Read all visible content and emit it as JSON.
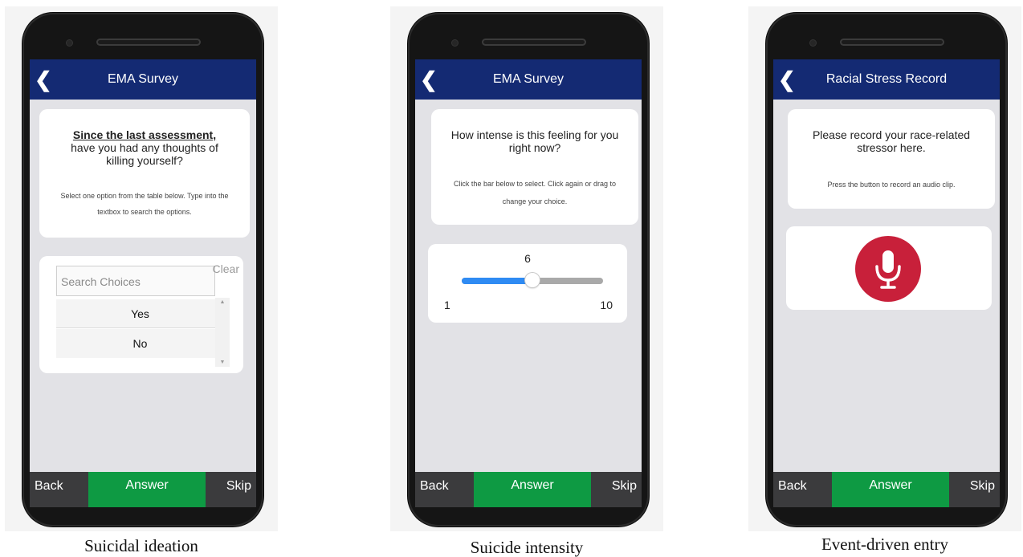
{
  "panels": [
    {
      "header_title": "EMA Survey",
      "question_emphasis": "Since the last assessment,",
      "question_line2": "have you had any thoughts of",
      "question_line3": "killing yourself?",
      "instruction_line1": "Select one option from the table below. Type into the",
      "instruction_line2": "textbox to search the options.",
      "search_placeholder": "Search Choices",
      "clear_label": "Clear",
      "choices": [
        "Yes",
        "No"
      ],
      "footer": {
        "back": "Back",
        "answer": "Answer",
        "skip": "Skip"
      },
      "caption": "Suicidal ideation"
    },
    {
      "header_title": "EMA Survey",
      "question_line1": "How intense is this feeling for you",
      "question_line2": "right now?",
      "instruction_line1": "Click the bar below to select. Click again or drag to",
      "instruction_line2": "change your choice.",
      "slider": {
        "value": "6",
        "min": "1",
        "max": "10",
        "fraction": 0.5
      },
      "footer": {
        "back": "Back",
        "answer": "Answer",
        "skip": "Skip"
      },
      "caption": "Suicide intensity"
    },
    {
      "header_title": "Racial Stress Record",
      "question_line1": "Please record your race-related",
      "question_line2": "stressor here.",
      "instruction_line1": "Press the button to record an audio clip.",
      "footer": {
        "back": "Back",
        "answer": "Answer",
        "skip": "Skip"
      },
      "caption": "Event-driven entry"
    }
  ],
  "colors": {
    "header": "#142a73",
    "answer": "#0e9a43",
    "mic": "#c8203a",
    "slider_fill": "#2f8bf3"
  },
  "icons": [
    "back-chevron-icon",
    "microphone-icon",
    "scroll-up-arrow-icon",
    "scroll-down-arrow-icon"
  ]
}
